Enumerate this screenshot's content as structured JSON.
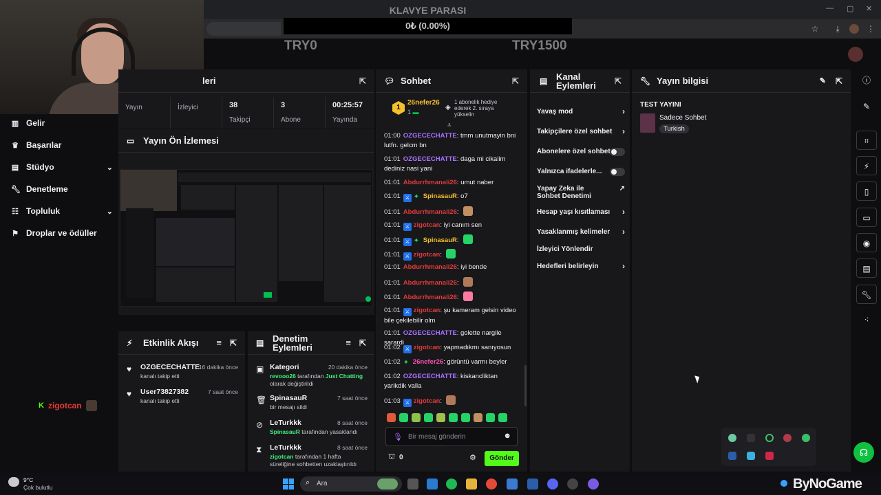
{
  "overlay": {
    "title": "KLAVYE PARASI",
    "value": "0₺ (0.00%)",
    "try_left": "TRY0",
    "try_right": "TRY1500"
  },
  "nav": [
    {
      "icon": "bar-chart-icon",
      "label": "Gelir"
    },
    {
      "icon": "trophy-icon",
      "label": "Başarılar"
    },
    {
      "icon": "studio-icon",
      "label": "Stüdyo"
    },
    {
      "icon": "wrench-icon",
      "label": "Denetleme"
    },
    {
      "icon": "community-icon",
      "label": "Topluluk"
    },
    {
      "icon": "drops-icon",
      "label": "Droplar ve ödüller"
    }
  ],
  "stats": {
    "title": "leri",
    "items": [
      {
        "value": "",
        "label": "Yayın"
      },
      {
        "value": "",
        "label": "İzleyici"
      },
      {
        "value": "38",
        "label": "Takipçi"
      },
      {
        "value": "3",
        "label": "Abone"
      },
      {
        "value": "00:25:57",
        "label": "Yayında"
      }
    ]
  },
  "preview": {
    "title": "Yayın Ön İzlemesi"
  },
  "activity": {
    "title": "Etkinlik Akışı",
    "items": [
      {
        "user": "OZGECECHATTE",
        "time": "16 dakika önce",
        "desc": "kanalı takip etti"
      },
      {
        "user": "User73827382",
        "time": "7 saat önce",
        "desc": "kanalı takip etti"
      }
    ]
  },
  "overlay_user": "zigotcan",
  "modactions": {
    "title": "Denetim Eylemleri",
    "items": [
      {
        "who": "Kategori",
        "time": "20 dakika önce",
        "actor": "revooo26",
        "mid": " tarafından ",
        "extra": "Just Chatting",
        "tail": " olarak değiştirildi"
      },
      {
        "who": "SpinasauR",
        "time": "7 saat önce",
        "actor": "",
        "mid": "",
        "extra": "",
        "tail": "bir mesajı sildi"
      },
      {
        "who": "LeTurkkk",
        "time": "8 saat önce",
        "actor": "SpinasauR",
        "mid": " tarafından yasaklandı",
        "extra": "",
        "tail": ""
      },
      {
        "who": "LeTurkkk",
        "time": "8 saat önce",
        "actor": "zigotcan",
        "mid": " tarafından 1 hafta süreliğine sohbetten uzaklaştırıldı",
        "extra": "",
        "tail": ""
      }
    ]
  },
  "chat": {
    "title": "Sohbet",
    "gift_user": "26nefer26",
    "gift_rank": "1",
    "gift_count": "1",
    "gift_text": "1 abonelik hediye ederek 2. sıraya yükselin",
    "messages": [
      {
        "t": "01:00",
        "user": "OZGECECHATTE",
        "c": "purple",
        "msg": ": tmm unutmayin bni lutfn. gelcm bn"
      },
      {
        "t": "01:01",
        "user": "OZGECECHATTE",
        "c": "purple",
        "msg": ": daga mi cikalim dediniz nasi yani"
      },
      {
        "t": "01:01",
        "user": "Abdurrhmanali26",
        "c": "red",
        "msg": ": umut naber"
      },
      {
        "t": "01:01",
        "user": "SpinasauR",
        "c": "gold",
        "msg": ": o7"
      },
      {
        "t": "01:01",
        "user": "Abdurrhmanali26",
        "c": "red",
        "msg": ":"
      },
      {
        "t": "01:01",
        "user": "zigotcan",
        "c": "red",
        "msg": ": iyi canım sen"
      },
      {
        "t": "01:01",
        "user": "SpinasauR",
        "c": "gold",
        "msg": ":"
      },
      {
        "t": "01:01",
        "user": "zigotcan",
        "c": "red",
        "msg": ":"
      },
      {
        "t": "01:01",
        "user": "Abdurrhmanali26",
        "c": "red",
        "msg": ": iyi bende"
      },
      {
        "t": "01:01",
        "user": "Abdurrhmanali26",
        "c": "red",
        "msg": ":"
      },
      {
        "t": "01:01",
        "user": "Abdurrhmanali26",
        "c": "red",
        "msg": ":"
      },
      {
        "t": "01:01",
        "user": "zigotcan",
        "c": "red",
        "msg": ": şu kameram gelsin video bile çekilebilir olm"
      },
      {
        "t": "01:01",
        "user": "OZGECECHATTE",
        "c": "purple",
        "msg": ": golette nargile sarardi"
      },
      {
        "t": "01:02",
        "user": "zigotcan",
        "c": "red",
        "msg": ": yapmadıkmı sanıyosun"
      },
      {
        "t": "01:02",
        "user": "26nefer26",
        "c": "pink",
        "msg": ": görüntü varmı beyler"
      },
      {
        "t": "01:02",
        "user": "OZGECECHATTE",
        "c": "purple",
        "msg": ": kiskancliktan yarikdik valla"
      },
      {
        "t": "01:03",
        "user": "zigotcan",
        "c": "red",
        "msg": ":"
      }
    ],
    "input_placeholder": "Bir mesaj gönderin",
    "points": "0",
    "send": "Gönder"
  },
  "channel_actions": {
    "title": "Kanal Eylemleri",
    "items": [
      {
        "label": "Yavaş mod",
        "kind": "chevron"
      },
      {
        "label": "Takipçilere özel sohbet",
        "kind": "chevron"
      },
      {
        "label": "Abonelere özel sohbet",
        "kind": "toggle"
      },
      {
        "label": "Yalnızca ifadelerle...",
        "kind": "toggle"
      },
      {
        "label": "Yapay Zeka ile Sohbet Denetimi",
        "kind": "external"
      },
      {
        "label": "Hesap yaşı kısıtlaması",
        "kind": "chevron"
      },
      {
        "label": "Yasaklanmış kelimeler",
        "kind": "chevron"
      },
      {
        "label": "İzleyici Yönlendir",
        "kind": "none"
      },
      {
        "label": "Hedefleri belirleyin",
        "kind": "chevron"
      }
    ]
  },
  "stream_info": {
    "title": "Yayın bilgisi",
    "stream_title": "TEST YAYINI",
    "category": "Sadece Sohbet",
    "language": "Turkish"
  },
  "taskbar": {
    "weather_temp": "9°C",
    "weather_desc": "Çok bulutlu",
    "search": "Ara",
    "brand": "ByNoGame"
  },
  "colors": {
    "accent_green": "#00c050",
    "bg": "#0e0e10",
    "panel": "#18181b"
  }
}
